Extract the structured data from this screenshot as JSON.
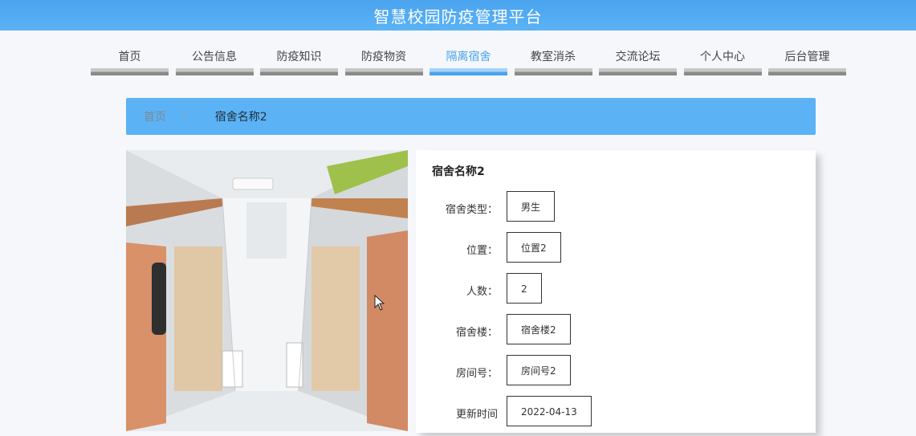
{
  "header": {
    "title": "智慧校园防疫管理平台"
  },
  "nav": {
    "items": [
      {
        "label": "首页"
      },
      {
        "label": "公告信息"
      },
      {
        "label": "防疫知识"
      },
      {
        "label": "防疫物资"
      },
      {
        "label": "隔离宿舍",
        "active": true
      },
      {
        "label": "教室消杀"
      },
      {
        "label": "交流论坛"
      },
      {
        "label": "个人中心"
      },
      {
        "label": "后台管理"
      }
    ]
  },
  "breadcrumb": {
    "home": "首页",
    "separator": "/",
    "current": "宿舍名称2"
  },
  "dorm": {
    "name": "宿舍名称2",
    "fields": [
      {
        "label": "宿舍类型：",
        "value": "男生"
      },
      {
        "label": "位置：",
        "value": "位置2"
      },
      {
        "label": "人数：",
        "value": "2"
      },
      {
        "label": "宿舍楼：",
        "value": "宿舍楼2"
      },
      {
        "label": "房间号：",
        "value": "房间号2"
      },
      {
        "label": "更新时间",
        "value": "2022-04-13"
      }
    ]
  },
  "colors": {
    "accent": "#5bb3f5",
    "header": "#4aa3ee"
  }
}
